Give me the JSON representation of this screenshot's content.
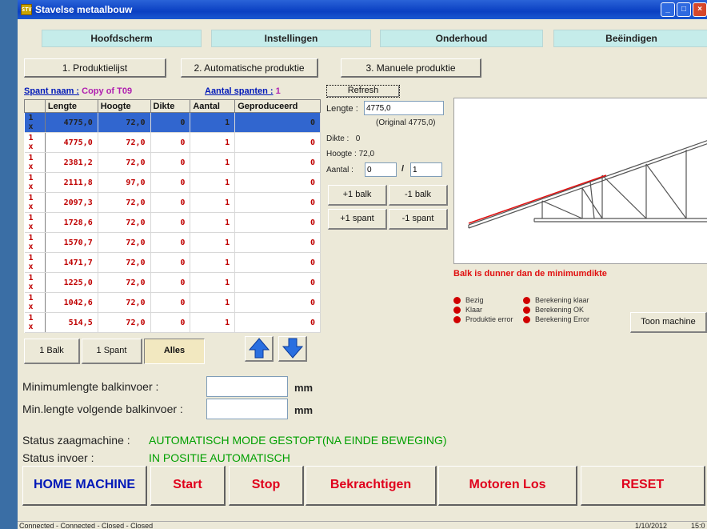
{
  "window": {
    "title": "Stavelse metaalbouw",
    "icon_text": "STV"
  },
  "nav": [
    "Hoofdscherm",
    "Instellingen",
    "Onderhoud",
    "Beëindigen"
  ],
  "tabs": [
    "1. Produktielijst",
    "2. Automatische produktie",
    "3. Manuele produktie"
  ],
  "spant": {
    "name_label": "Spant naam :",
    "name_value": "Copy of T09",
    "count_label": "Aantal spanten :",
    "count_value": "1"
  },
  "refresh_label": "Refresh",
  "table": {
    "headers": [
      "",
      "Lengte",
      "Hoogte",
      "Dikte",
      "Aantal",
      "Geproduceerd"
    ],
    "rows": [
      [
        "1 x",
        "4775,0",
        "72,0",
        "0",
        "1",
        "0"
      ],
      [
        "1 x",
        "4775,0",
        "72,0",
        "0",
        "1",
        "0"
      ],
      [
        "1 x",
        "2381,2",
        "72,0",
        "0",
        "1",
        "0"
      ],
      [
        "1 x",
        "2111,8",
        "97,0",
        "0",
        "1",
        "0"
      ],
      [
        "1 x",
        "2097,3",
        "72,0",
        "0",
        "1",
        "0"
      ],
      [
        "1 x",
        "1728,6",
        "72,0",
        "0",
        "1",
        "0"
      ],
      [
        "1 x",
        "1570,7",
        "72,0",
        "0",
        "1",
        "0"
      ],
      [
        "1 x",
        "1471,7",
        "72,0",
        "0",
        "1",
        "0"
      ],
      [
        "1 x",
        "1225,0",
        "72,0",
        "0",
        "1",
        "0"
      ],
      [
        "1 x",
        "1042,6",
        "72,0",
        "0",
        "1",
        "0"
      ],
      [
        "1 x",
        "514,5",
        "72,0",
        "0",
        "1",
        "0"
      ]
    ]
  },
  "details": {
    "lengte_label": "Lengte :",
    "lengte_value": "4775,0",
    "original": "(Original 4775,0)",
    "dikte_label": "Dikte :",
    "dikte_value": "0",
    "hoogte_label": "Hoogte :",
    "hoogte_value": "72,0",
    "aantal_label": "Aantal :",
    "aantal_value": "0",
    "aantal_sep": "/",
    "aantal_total": "1"
  },
  "adjust_buttons": [
    "+1 balk",
    "-1 balk",
    "+1 spant",
    "-1 spant"
  ],
  "warning": "Balk is dunner dan de minimumdikte",
  "legend": [
    "Bezig",
    "Klaar",
    "Produktie error",
    "Berekening klaar",
    "Berekening OK",
    "Berekening Error"
  ],
  "toon_machine": "Toon machine",
  "filter_buttons": [
    "1 Balk",
    "1 Spant",
    "Alles"
  ],
  "inputs": {
    "min_label": "Minimumlengte balkinvoer :",
    "min_value": "",
    "next_label": "Min.lengte volgende  balkinvoer :",
    "next_value": "",
    "unit": "mm"
  },
  "status": {
    "saw_label": "Status zaagmachine :",
    "saw_value": "AUTOMATISCH MODE GESTOPT(NA EINDE BEWEGING)",
    "feed_label": "Status invoer :",
    "feed_value": "IN POSITIE AUTOMATISCH"
  },
  "big_buttons": [
    "HOME MACHINE",
    "Start",
    "Stop",
    "Bekrachtigen",
    "Motoren Los",
    "RESET"
  ],
  "statusbar": {
    "connection": "Connected - Connected - Closed - Closed",
    "date": "1/10/2012",
    "time": "15:0"
  },
  "colors": {
    "accent_blue": "#0018b8",
    "status_green": "#00a000",
    "warning_red": "#e01010",
    "nav_cyan": "#c5ecea"
  }
}
